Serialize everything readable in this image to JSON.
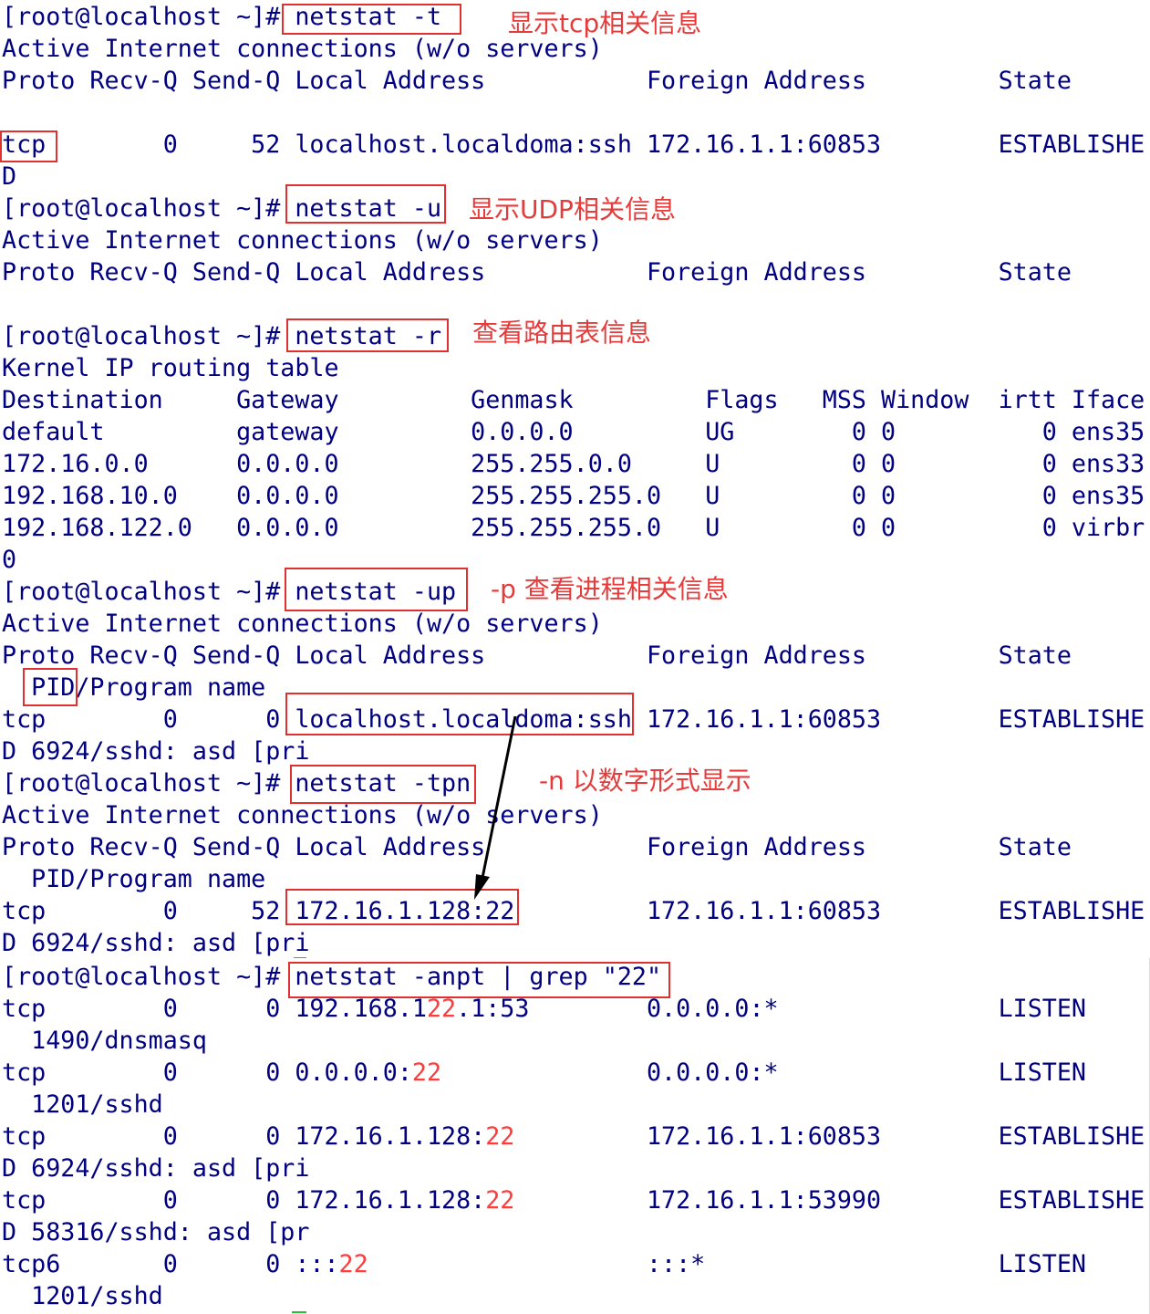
{
  "terminal": {
    "lines": [
      "[root@localhost ~]# netstat -t",
      "Active Internet connections (w/o servers)",
      "Proto Recv-Q Send-Q Local Address           Foreign Address         State",
      "",
      "tcp        0     52 localhost.localdoma:ssh 172.16.1.1:60853        ESTABLISHE",
      "D",
      "[root@localhost ~]# netstat -u",
      "Active Internet connections (w/o servers)",
      "Proto Recv-Q Send-Q Local Address           Foreign Address         State",
      "",
      "[root@localhost ~]# netstat -r",
      "Kernel IP routing table",
      "Destination     Gateway         Genmask         Flags   MSS Window  irtt Iface",
      "default         gateway         0.0.0.0         UG        0 0          0 ens35",
      "172.16.0.0      0.0.0.0         255.255.0.0     U         0 0          0 ens33",
      "192.168.10.0    0.0.0.0         255.255.255.0   U         0 0          0 ens35",
      "192.168.122.0   0.0.0.0         255.255.255.0   U         0 0          0 virbr",
      "0",
      "[root@localhost ~]# netstat -up",
      "Active Internet connections (w/o servers)",
      "Proto Recv-Q Send-Q Local Address           Foreign Address         State",
      "  PID/Program name",
      "tcp        0      0 localhost.localdoma:ssh 172.16.1.1:60853        ESTABLISHE",
      "D 6924/sshd: asd [pri",
      "[root@localhost ~]# netstat -tpn",
      "Active Internet connections (w/o servers)",
      "Proto Recv-Q Send-Q Local Address           Foreign Address         State",
      "  PID/Program name",
      "tcp        0     52 172.16.1.128:22         172.16.1.1:60853        ESTABLISHE",
      "D 6924/sshd: asd [pri"
    ],
    "grep_command": "[root@localhost ~]# netstat -anpt | grep \"22\"",
    "grep_results": [
      {
        "a": "tcp        0      0 192.168.1",
        "hl": "22",
        "b": ".1:53        0.0.0.0:*               LISTEN"
      },
      {
        "a": "  1490/dnsmasq",
        "hl": "",
        "b": ""
      },
      {
        "a": "tcp        0      0 0.0.0.0:",
        "hl": "22",
        "b": "              0.0.0.0:*               LISTEN"
      },
      {
        "a": "  1201/sshd",
        "hl": "",
        "b": ""
      },
      {
        "a": "tcp        0      0 172.16.1.128:",
        "hl": "22",
        "b": "         172.16.1.1:60853        ESTABLISHE"
      },
      {
        "a": "D 6924/sshd: asd [pri",
        "hl": "",
        "b": ""
      },
      {
        "a": "tcp        0      0 172.16.1.128:",
        "hl": "22",
        "b": "         172.16.1.1:53990        ESTABLISHE"
      },
      {
        "a": "D 58316/sshd: asd [pr",
        "hl": "",
        "b": ""
      },
      {
        "a": "tcp6       0      0 :::",
        "hl": "22",
        "b": "                   :::*                    LISTEN"
      },
      {
        "a": "  1201/sshd",
        "hl": "",
        "b": ""
      }
    ]
  },
  "annotations": {
    "tcp": "显示tcp相关信息",
    "udp": "显示UDP相关信息",
    "route": "查看路由表信息",
    "process": "-p 查看进程相关信息",
    "numeric": "-n 以数字形式显示"
  },
  "colors": {
    "text": "#000080",
    "annotation": "#e63b3b",
    "highlight": "#ff3b3b",
    "box": "#e03030"
  }
}
